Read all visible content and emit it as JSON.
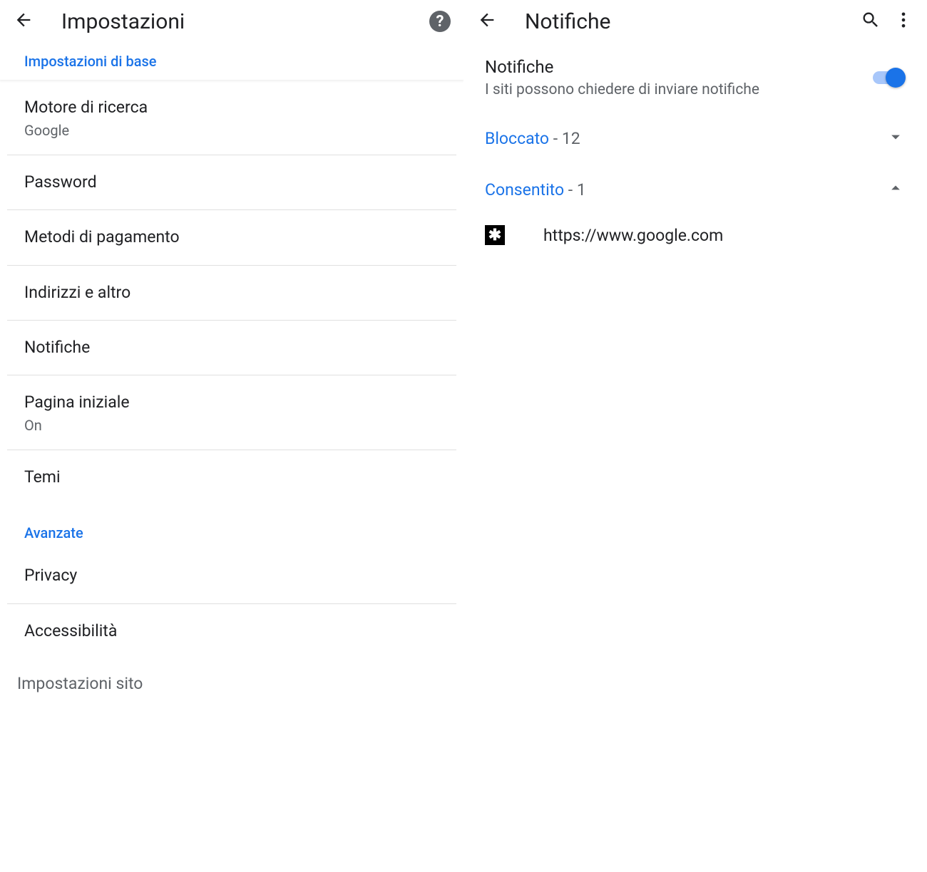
{
  "colors": {
    "accent": "#1a73e8",
    "textPrimary": "#202124",
    "textSecondary": "#5f6368"
  },
  "left": {
    "header": {
      "title": "Impostazioni"
    },
    "section_basic": "Impostazioni di base",
    "rows": {
      "search_engine": {
        "title": "Motore di ricerca",
        "value": "Google"
      },
      "password": {
        "title": "Password"
      },
      "payment": {
        "title": "Metodi di pagamento"
      },
      "addresses": {
        "title": "Indirizzi e altro"
      },
      "notifications": {
        "title": "Notifiche"
      },
      "homepage": {
        "title": "Pagina iniziale",
        "value": "On"
      },
      "themes": {
        "title": "Temi"
      }
    },
    "section_advanced": "Avanzate",
    "rows_adv": {
      "privacy": {
        "title": "Privacy"
      },
      "accessibility": {
        "title": "Accessibilità"
      },
      "site_settings": {
        "title": "Impostazioni sito"
      }
    }
  },
  "right": {
    "header": {
      "title": "Notifiche"
    },
    "main": {
      "title": "Notifiche",
      "subtitle": "I siti possono chiedere di inviare notifiche",
      "toggle": true
    },
    "blocked": {
      "label": "Bloccato",
      "count": "12"
    },
    "allowed": {
      "label": "Consentito",
      "count": "1"
    },
    "sites": [
      {
        "url": "https://www.google.com"
      }
    ]
  }
}
